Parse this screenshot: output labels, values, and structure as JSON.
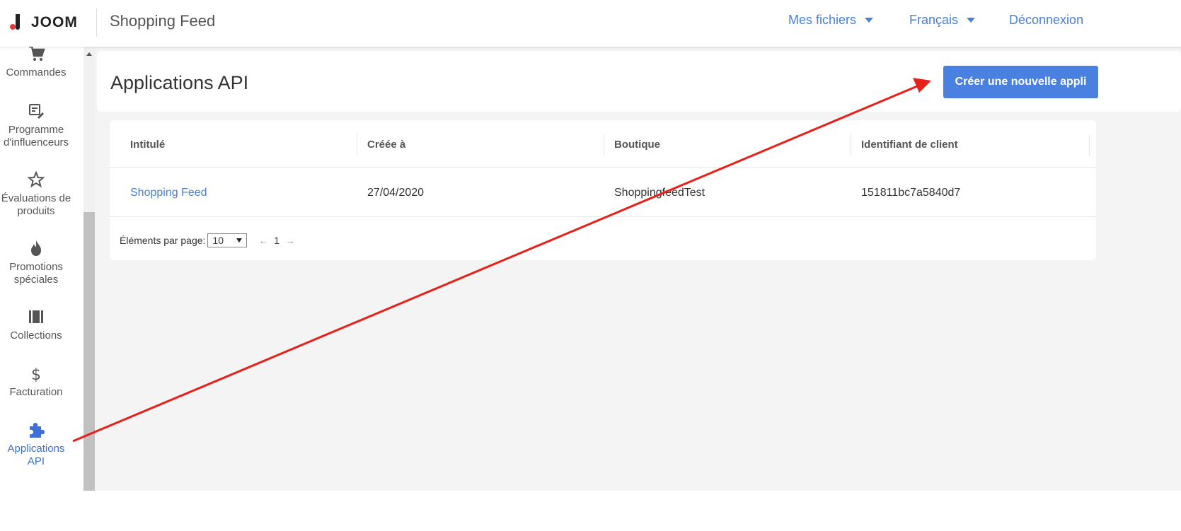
{
  "topbar": {
    "logo_text": "JOOM",
    "app_title": "Shopping Feed",
    "files_label": "Mes fichiers",
    "language_label": "Français",
    "logout_label": "Déconnexion"
  },
  "sidebar": {
    "items": [
      {
        "label": "Commandes",
        "icon": "cart-icon"
      },
      {
        "label": "Programme d'influenceurs",
        "icon": "influencer-icon"
      },
      {
        "label": "Évaluations de produits",
        "icon": "star-icon"
      },
      {
        "label": "Promotions spéciales",
        "icon": "flame-icon"
      },
      {
        "label": "Collections",
        "icon": "collections-icon"
      },
      {
        "label": "Facturation",
        "icon": "dollar-icon"
      },
      {
        "label": "Applications API",
        "icon": "puzzle-icon",
        "active": true
      }
    ]
  },
  "main": {
    "page_title": "Applications API",
    "create_button": "Créer une nouvelle appli",
    "table": {
      "headers": [
        "Intitulé",
        "Créée à",
        "Boutique",
        "Identifiant de client"
      ],
      "rows": [
        [
          "Shopping Feed",
          "27/04/2020",
          "ShoppingfeedTest",
          "151811bc7a5840d7"
        ]
      ]
    },
    "pagination": {
      "per_page_label": "Éléments par page:",
      "per_page_value": "10",
      "prev": "←",
      "page": "1",
      "next": "→"
    }
  },
  "colors": {
    "accent": "#4a80e0",
    "link": "#4a7fd6",
    "annotation_arrow": "#e8201a"
  }
}
